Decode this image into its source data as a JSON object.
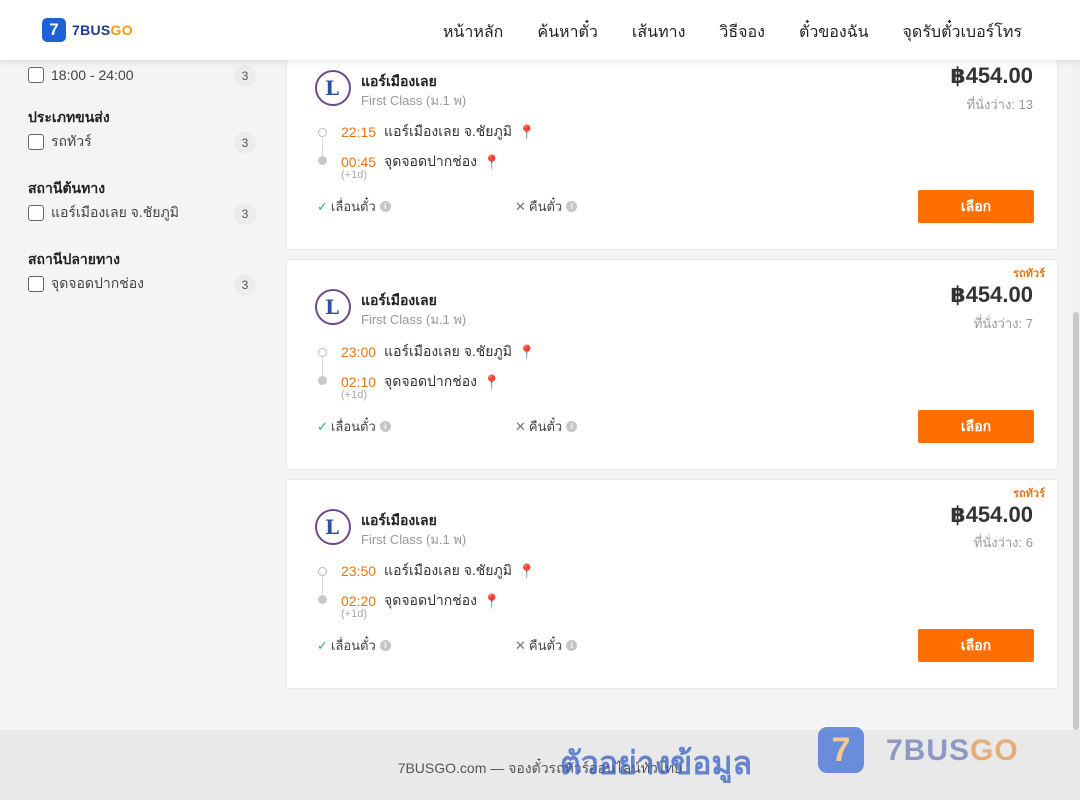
{
  "header": {
    "logo_mark": "7",
    "logo_text_a": "7BUS",
    "logo_text_b": "GO",
    "nav": [
      "หน้าหลัก",
      "ค้นหาตั๋ว",
      "เส้นทาง",
      "วิธีจอง",
      "ตั๋วของฉัน",
      "จุดรับตั๋วเบอร์โทร"
    ]
  },
  "sidebar": {
    "time_filter": {
      "label": "18:00 - 24:00",
      "count": "3"
    },
    "groups": [
      {
        "title": "ประเภทขนส่ง",
        "option": "รถทัวร์",
        "count": "3"
      },
      {
        "title": "สถานีต้นทาง",
        "option": "แอร์เมืองเลย จ.ชัยภูมิ",
        "count": "3"
      },
      {
        "title": "สถานีปลายทาง",
        "option": "จุดจอดปากช่อง",
        "count": "3"
      }
    ]
  },
  "trips": [
    {
      "badge": "",
      "operator": "แอร์เมืองเลย",
      "class": "First Class (ม.1 พ)",
      "price": "฿454.00",
      "seats": "ที่นั่งว่าง: 13",
      "depart_time": "22:15",
      "depart_station": "แอร์เมืองเลย จ.ชัยภูมิ",
      "arrive_time": "00:45",
      "arrive_station": "จุดจอดปากช่อง",
      "next_day": "(+1d)",
      "refund_seat": "เลื่อนตั๋ว",
      "refund_ticket": "คืนตั๋ว",
      "select": "เลือก"
    },
    {
      "badge": "รถทัวร์",
      "operator": "แอร์เมืองเลย",
      "class": "First Class (ม.1 พ)",
      "price": "฿454.00",
      "seats": "ที่นั่งว่าง: 7",
      "depart_time": "23:00",
      "depart_station": "แอร์เมืองเลย จ.ชัยภูมิ",
      "arrive_time": "02:10",
      "arrive_station": "จุดจอดปากช่อง",
      "next_day": "(+1d)",
      "refund_seat": "เลื่อนตั๋ว",
      "refund_ticket": "คืนตั๋ว",
      "select": "เลือก"
    },
    {
      "badge": "รถทัวร์",
      "operator": "แอร์เมืองเลย",
      "class": "First Class (ม.1 พ)",
      "price": "฿454.00",
      "seats": "ที่นั่งว่าง: 6",
      "depart_time": "23:50",
      "depart_station": "แอร์เมืองเลย จ.ชัยภูมิ",
      "arrive_time": "02:20",
      "arrive_station": "จุดจอดปากช่อง",
      "next_day": "(+1d)",
      "refund_seat": "เลื่อนตั๋ว",
      "refund_ticket": "คืนตั๋ว",
      "select": "เลือก"
    }
  ],
  "footer": {
    "text": "7BUSGO.com — จองตั๋วรถทัวร์ออนไลน์ทั่วไทย",
    "watermark_text": "ตัวอย่างข้อมูล",
    "watermark_mark": "7",
    "watermark_brand_a": "7BUS",
    "watermark_brand_b": "GO"
  },
  "colors": {
    "accent": "#ff6f00",
    "time": "#e8750c",
    "brand": "#1e63d6"
  }
}
